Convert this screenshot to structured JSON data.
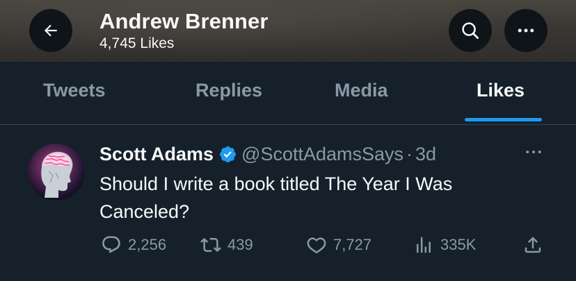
{
  "header": {
    "title": "Andrew Brenner",
    "subtitle": "4,745 Likes",
    "icons": {
      "back": "arrow-left-icon",
      "search": "search-icon",
      "more": "more-horizontal-icon"
    }
  },
  "tabs": [
    {
      "label": "Tweets",
      "active": false
    },
    {
      "label": "Replies",
      "active": false
    },
    {
      "label": "Media",
      "active": false
    },
    {
      "label": "Likes",
      "active": true
    }
  ],
  "tweet": {
    "author_name": "Scott Adams",
    "handle": "@ScottAdamsSays",
    "separator": "·",
    "time": "3d",
    "verified": true,
    "text": "Should I write a book titled The Year I Was Canceled?",
    "actions": {
      "replies": "2,256",
      "retweets": "439",
      "likes": "7,727",
      "views": "335K"
    }
  },
  "colors": {
    "background": "#15202b",
    "accent": "#1d9bf0",
    "muted_text": "#8b98a5",
    "primary_text": "#f7f9f9"
  }
}
